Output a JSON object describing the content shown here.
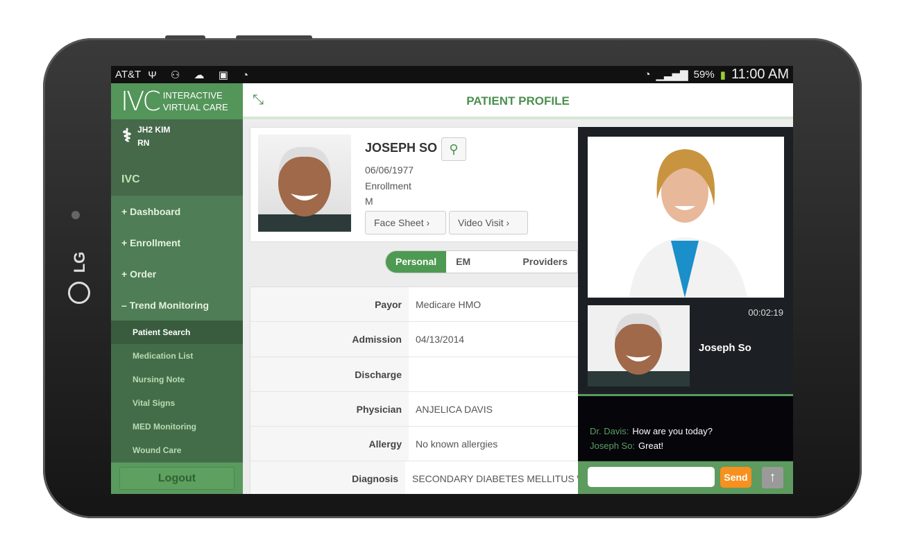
{
  "device": {
    "brand": "LG"
  },
  "status_bar": {
    "carrier": "AT&T",
    "battery": "59%",
    "time": "11:00 AM"
  },
  "app": {
    "logo_mark": "IVC",
    "logo_line1": "INTERACTIVE",
    "logo_line2": "VIRTUAL CARE",
    "header_title": "PATIENT PROFILE"
  },
  "user": {
    "name": "JH2 KIM",
    "role": "RN"
  },
  "sidebar": {
    "section": "IVC",
    "items": [
      {
        "label": "+ Dashboard"
      },
      {
        "label": "+ Enrollment"
      },
      {
        "label": "+ Order"
      },
      {
        "label": "– Trend Monitoring"
      }
    ],
    "subitems": [
      {
        "label": "Patient Search",
        "active": true
      },
      {
        "label": "Medication List"
      },
      {
        "label": "Nursing Note"
      },
      {
        "label": "Vital Signs"
      },
      {
        "label": "MED Monitoring"
      },
      {
        "label": "Wound Care"
      }
    ],
    "logout": "Logout"
  },
  "patient": {
    "name": "JOSEPH SO",
    "dob": "06/06/1977",
    "status": "Enrollment",
    "sex": "M",
    "face_sheet": "Face Sheet",
    "video_visit": "Video Visit"
  },
  "tabs": [
    {
      "label": "Personal",
      "active": true
    },
    {
      "label": "EM Contact"
    },
    {
      "label": "Providers"
    }
  ],
  "details": [
    {
      "k": "Payor",
      "v": "Medicare HMO"
    },
    {
      "k": "Admission",
      "v": "04/13/2014"
    },
    {
      "k": "Discharge",
      "v": ""
    },
    {
      "k": "Physician",
      "v": "ANJELICA DAVIS"
    },
    {
      "k": "Allergy",
      "v": "No known allergies"
    },
    {
      "k": "Diagnosis",
      "v": "SECONDARY DIABETES MELLITUS W"
    }
  ],
  "video": {
    "timer": "00:02:19",
    "caller": "Joseph So"
  },
  "chat": {
    "messages": [
      {
        "from": "Dr. Davis:",
        "text": "How are you today?"
      },
      {
        "from": "Joseph So:",
        "text": "Great!"
      }
    ],
    "input": "",
    "send": "Send"
  },
  "colors": {
    "primary": "#4e9a52",
    "send": "#f7901e"
  }
}
